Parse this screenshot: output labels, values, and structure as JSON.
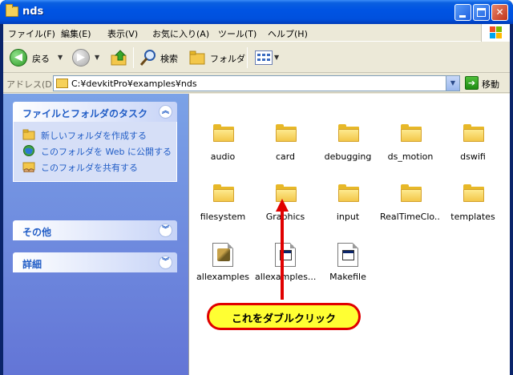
{
  "window": {
    "title": "nds",
    "minimize_label": "",
    "maximize_label": "",
    "close_label": "✕"
  },
  "menubar": {
    "items": [
      "ファイル(F)",
      "編集(E)",
      "表示(V)",
      "お気に入り(A)",
      "ツール(T)",
      "ヘルプ(H)"
    ]
  },
  "toolbar": {
    "back_label": "戻る",
    "search_label": "検索",
    "folders_label": "フォルダ"
  },
  "address": {
    "label": "アドレス(D)",
    "path": "C:¥devkitPro¥examples¥nds",
    "go_label": "移動"
  },
  "tasks_panel": {
    "title": "ファイルとフォルダのタスク",
    "items": [
      {
        "label": "新しいフォルダを作成する",
        "icon": "new-folder-icon"
      },
      {
        "label": "このフォルダを Web に公開する",
        "icon": "web-publish-icon"
      },
      {
        "label": "このフォルダを共有する",
        "icon": "share-folder-icon"
      }
    ]
  },
  "other_panel": {
    "title": "その他"
  },
  "details_panel": {
    "title": "詳細"
  },
  "files": [
    {
      "label": "audio",
      "type": "folder"
    },
    {
      "label": "card",
      "type": "folder"
    },
    {
      "label": "debugging",
      "type": "folder"
    },
    {
      "label": "ds_motion",
      "type": "folder"
    },
    {
      "label": "dswifi",
      "type": "folder"
    },
    {
      "label": "filesystem",
      "type": "folder"
    },
    {
      "label": "Graphics",
      "type": "folder"
    },
    {
      "label": "input",
      "type": "folder"
    },
    {
      "label": "RealTimeClo...",
      "type": "folder"
    },
    {
      "label": "templates",
      "type": "folder"
    },
    {
      "label": "allexamples",
      "type": "workspace-file"
    },
    {
      "label": "allexamples...",
      "type": "app-file"
    },
    {
      "label": "Makefile",
      "type": "app-file"
    }
  ],
  "annotation": {
    "text": "これをダブルクリック",
    "color": "#e00000",
    "fill": "#ffff33"
  }
}
